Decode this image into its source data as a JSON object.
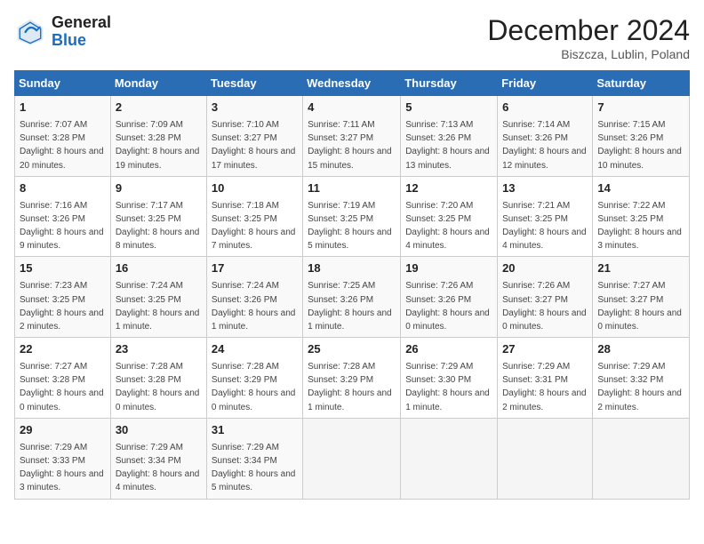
{
  "header": {
    "logo_line1": "General",
    "logo_line2": "Blue",
    "month_title": "December 2024",
    "location": "Biszcza, Lublin, Poland"
  },
  "days_of_week": [
    "Sunday",
    "Monday",
    "Tuesday",
    "Wednesday",
    "Thursday",
    "Friday",
    "Saturday"
  ],
  "weeks": [
    [
      {
        "day": "1",
        "sunrise": "7:07 AM",
        "sunset": "3:28 PM",
        "daylight": "8 hours and 20 minutes."
      },
      {
        "day": "2",
        "sunrise": "7:09 AM",
        "sunset": "3:28 PM",
        "daylight": "8 hours and 19 minutes."
      },
      {
        "day": "3",
        "sunrise": "7:10 AM",
        "sunset": "3:27 PM",
        "daylight": "8 hours and 17 minutes."
      },
      {
        "day": "4",
        "sunrise": "7:11 AM",
        "sunset": "3:27 PM",
        "daylight": "8 hours and 15 minutes."
      },
      {
        "day": "5",
        "sunrise": "7:13 AM",
        "sunset": "3:26 PM",
        "daylight": "8 hours and 13 minutes."
      },
      {
        "day": "6",
        "sunrise": "7:14 AM",
        "sunset": "3:26 PM",
        "daylight": "8 hours and 12 minutes."
      },
      {
        "day": "7",
        "sunrise": "7:15 AM",
        "sunset": "3:26 PM",
        "daylight": "8 hours and 10 minutes."
      }
    ],
    [
      {
        "day": "8",
        "sunrise": "7:16 AM",
        "sunset": "3:26 PM",
        "daylight": "8 hours and 9 minutes."
      },
      {
        "day": "9",
        "sunrise": "7:17 AM",
        "sunset": "3:25 PM",
        "daylight": "8 hours and 8 minutes."
      },
      {
        "day": "10",
        "sunrise": "7:18 AM",
        "sunset": "3:25 PM",
        "daylight": "8 hours and 7 minutes."
      },
      {
        "day": "11",
        "sunrise": "7:19 AM",
        "sunset": "3:25 PM",
        "daylight": "8 hours and 5 minutes."
      },
      {
        "day": "12",
        "sunrise": "7:20 AM",
        "sunset": "3:25 PM",
        "daylight": "8 hours and 4 minutes."
      },
      {
        "day": "13",
        "sunrise": "7:21 AM",
        "sunset": "3:25 PM",
        "daylight": "8 hours and 4 minutes."
      },
      {
        "day": "14",
        "sunrise": "7:22 AM",
        "sunset": "3:25 PM",
        "daylight": "8 hours and 3 minutes."
      }
    ],
    [
      {
        "day": "15",
        "sunrise": "7:23 AM",
        "sunset": "3:25 PM",
        "daylight": "8 hours and 2 minutes."
      },
      {
        "day": "16",
        "sunrise": "7:24 AM",
        "sunset": "3:25 PM",
        "daylight": "8 hours and 1 minute."
      },
      {
        "day": "17",
        "sunrise": "7:24 AM",
        "sunset": "3:26 PM",
        "daylight": "8 hours and 1 minute."
      },
      {
        "day": "18",
        "sunrise": "7:25 AM",
        "sunset": "3:26 PM",
        "daylight": "8 hours and 1 minute."
      },
      {
        "day": "19",
        "sunrise": "7:26 AM",
        "sunset": "3:26 PM",
        "daylight": "8 hours and 0 minutes."
      },
      {
        "day": "20",
        "sunrise": "7:26 AM",
        "sunset": "3:27 PM",
        "daylight": "8 hours and 0 minutes."
      },
      {
        "day": "21",
        "sunrise": "7:27 AM",
        "sunset": "3:27 PM",
        "daylight": "8 hours and 0 minutes."
      }
    ],
    [
      {
        "day": "22",
        "sunrise": "7:27 AM",
        "sunset": "3:28 PM",
        "daylight": "8 hours and 0 minutes."
      },
      {
        "day": "23",
        "sunrise": "7:28 AM",
        "sunset": "3:28 PM",
        "daylight": "8 hours and 0 minutes."
      },
      {
        "day": "24",
        "sunrise": "7:28 AM",
        "sunset": "3:29 PM",
        "daylight": "8 hours and 0 minutes."
      },
      {
        "day": "25",
        "sunrise": "7:28 AM",
        "sunset": "3:29 PM",
        "daylight": "8 hours and 1 minute."
      },
      {
        "day": "26",
        "sunrise": "7:29 AM",
        "sunset": "3:30 PM",
        "daylight": "8 hours and 1 minute."
      },
      {
        "day": "27",
        "sunrise": "7:29 AM",
        "sunset": "3:31 PM",
        "daylight": "8 hours and 2 minutes."
      },
      {
        "day": "28",
        "sunrise": "7:29 AM",
        "sunset": "3:32 PM",
        "daylight": "8 hours and 2 minutes."
      }
    ],
    [
      {
        "day": "29",
        "sunrise": "7:29 AM",
        "sunset": "3:33 PM",
        "daylight": "8 hours and 3 minutes."
      },
      {
        "day": "30",
        "sunrise": "7:29 AM",
        "sunset": "3:34 PM",
        "daylight": "8 hours and 4 minutes."
      },
      {
        "day": "31",
        "sunrise": "7:29 AM",
        "sunset": "3:34 PM",
        "daylight": "8 hours and 5 minutes."
      },
      null,
      null,
      null,
      null
    ]
  ]
}
